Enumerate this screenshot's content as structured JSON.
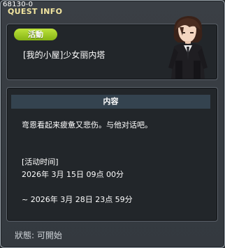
{
  "quest": {
    "id": "68130-0",
    "window_title": "QUEST INFO",
    "badge": "活動",
    "name": "[我的小屋]少女丽内塔",
    "section_header": "内容",
    "description": "弯恩看起来疲惫又悲伤。与他对话吧。",
    "time_label": "[活动时间]",
    "start_time": "2026年 3月 15日 09点 00分",
    "end_time": "~ 2026年 3月 28日 23点 59分",
    "status": "狀態: 可開始"
  },
  "colors": {
    "title": "#f3e6a0",
    "badge": "#9ccc22",
    "panel": "#22262a",
    "header": "#34434f"
  },
  "icons": {
    "portrait": "character-portrait"
  }
}
